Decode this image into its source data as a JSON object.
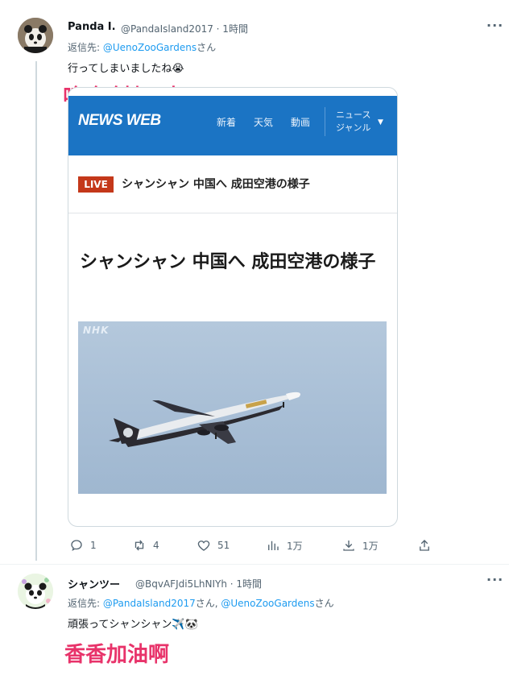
{
  "tweet1": {
    "display_name": "Panda I.",
    "handle_time": "@PandaIsland2017 · 1時間",
    "reply_prefix": "返信先: ",
    "reply_target": "@UenoZooGardens",
    "reply_suffix": "さん",
    "text": "行ってしまいましたね😭",
    "overlay_caption": "呜呜呜她飞走了",
    "more": "···"
  },
  "card": {
    "logo": "NEWS WEB",
    "nav": [
      "新着",
      "天気",
      "動画"
    ],
    "genre_line1": "ニュース",
    "genre_line2": "ジャンル",
    "caret": "▼",
    "live_badge": "LIVE",
    "live_title": "シャンシャン 中国へ 成田空港の様子",
    "headline": "シャンシャン 中国へ 成田空港の様子",
    "photo_mark": "NHK"
  },
  "actions": {
    "reply_count": "1",
    "retweet_count": "4",
    "like_count": "51",
    "views_count": "1万",
    "bookmark_count": "1万"
  },
  "tweet2": {
    "display_name": "シャンツー",
    "handle_time": "@BqvAFJdi5LhNIYh · 1時間",
    "reply_prefix": "返信先: ",
    "reply_target1": "@PandaIsland2017",
    "reply_mid": "さん, ",
    "reply_target2": "@UenoZooGardens",
    "reply_suffix": "さん",
    "text": "頑張ってシャンシャン✈️🐼",
    "overlay_caption": "香香加油啊",
    "more": "···"
  },
  "colors": {
    "link": "#1d9bf0",
    "nhk_blue": "#1b74c4",
    "live_red": "#c4381a",
    "caption_pink": "#e8336a"
  }
}
